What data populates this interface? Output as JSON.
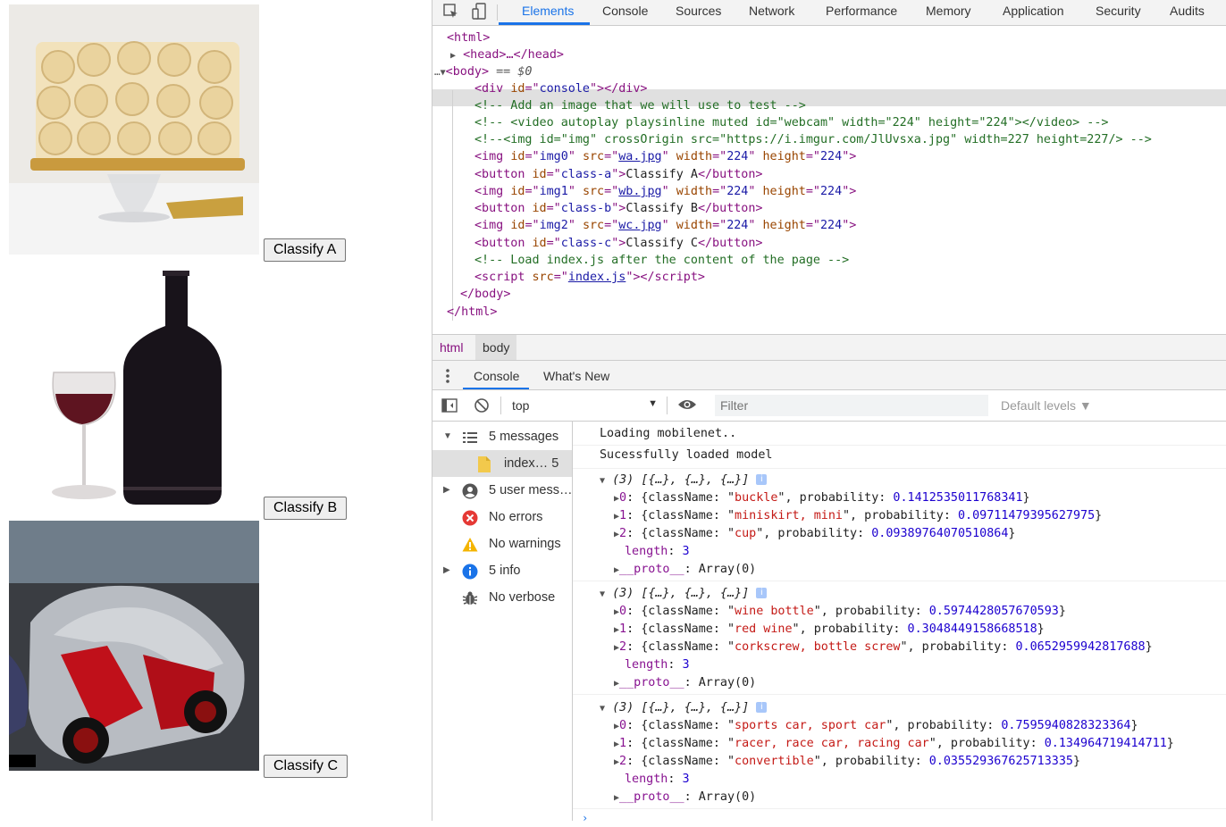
{
  "page": {
    "buttons": [
      "Classify A",
      "Classify B",
      "Classify C"
    ],
    "images": [
      "rose-cake",
      "wine-bottle-glass",
      "red-silver-supercar"
    ]
  },
  "devtools": {
    "tabs": [
      "Elements",
      "Console",
      "Sources",
      "Network",
      "Performance",
      "Memory",
      "Application",
      "Security",
      "Audits"
    ],
    "active_tab": "Elements",
    "dom_lines": {
      "html_open": "<html>",
      "head": "<head>…</head>",
      "body_open": "<body>",
      "body_marker": "== $0",
      "div_console": [
        "<div ",
        "id",
        "=\"",
        "console",
        "\"></div>"
      ],
      "c1": "<!-- Add an image that we will use to test -->",
      "c2": "<!-- <video autoplay playsinline muted id=\"webcam\" width=\"224\" height=\"224\"></video> -->",
      "c3": "<!--<img id=\"img\" crossOrigin src=\"https://i.imgur.com/JlUvsxa.jpg\" width=227 height=227/> -->",
      "img0": {
        "id": "img0",
        "src": "wa.jpg",
        "width": "224",
        "height": "224"
      },
      "btn_a": {
        "id": "class-a",
        "text": "Classify A"
      },
      "img1": {
        "id": "img1",
        "src": "wb.jpg",
        "width": "224",
        "height": "224"
      },
      "btn_b": {
        "id": "class-b",
        "text": "Classify B"
      },
      "img2": {
        "id": "img2",
        "src": "wc.jpg",
        "width": "224",
        "height": "224"
      },
      "btn_c": {
        "id": "class-c",
        "text": "Classify C"
      },
      "c4": "<!-- Load index.js after the content of the page -->",
      "script_src": "index.js",
      "body_close": "</body>",
      "html_close": "</html>"
    },
    "breadcrumbs": [
      "html",
      "body"
    ],
    "drawer_tabs": [
      "Console",
      "What's New"
    ],
    "console_toolbar": {
      "context": "top",
      "filter_placeholder": "Filter",
      "levels": "Default levels ▼"
    },
    "sidebar": [
      {
        "label": "5 messages",
        "icon": "list-icon",
        "expandable": true,
        "expanded": true
      },
      {
        "label": "index… 5",
        "icon": "file-icon",
        "expandable": false,
        "selected": true
      },
      {
        "label": "5 user mess…",
        "icon": "user-icon",
        "expandable": true
      },
      {
        "label": "No errors",
        "icon": "error-icon",
        "expandable": false
      },
      {
        "label": "No warnings",
        "icon": "warning-icon",
        "expandable": false
      },
      {
        "label": "5 info",
        "icon": "info-icon",
        "expandable": true
      },
      {
        "label": "No verbose",
        "icon": "bug-icon",
        "expandable": false
      }
    ],
    "console": {
      "log1": "Loading mobilenet..",
      "log2": "Sucessfully loaded model",
      "results": [
        {
          "header": "(3) [{…}, {…}, {…}]",
          "items": [
            {
              "index": "0",
              "className": "buckle",
              "probability": "0.1412535011768341"
            },
            {
              "index": "1",
              "className": "miniskirt, mini",
              "probability": "0.09711479395627975"
            },
            {
              "index": "2",
              "className": "cup",
              "probability": "0.09389764070510864"
            }
          ],
          "length": "3",
          "proto": "Array(0)"
        },
        {
          "header": "(3) [{…}, {…}, {…}]",
          "items": [
            {
              "index": "0",
              "className": "wine bottle",
              "probability": "0.5974428057670593"
            },
            {
              "index": "1",
              "className": "red wine",
              "probability": "0.3048449158668518"
            },
            {
              "index": "2",
              "className": "corkscrew, bottle screw",
              "probability": "0.0652959942817688"
            }
          ],
          "length": "3",
          "proto": "Array(0)"
        },
        {
          "header": "(3) [{…}, {…}, {…}]",
          "items": [
            {
              "index": "0",
              "className": "sports car, sport car",
              "probability": "0.7595940828323364"
            },
            {
              "index": "1",
              "className": "racer, race car, racing car",
              "probability": "0.134964719414711"
            },
            {
              "index": "2",
              "className": "convertible",
              "probability": "0.035529367625713335"
            }
          ],
          "length": "3",
          "proto": "Array(0)"
        }
      ]
    }
  }
}
